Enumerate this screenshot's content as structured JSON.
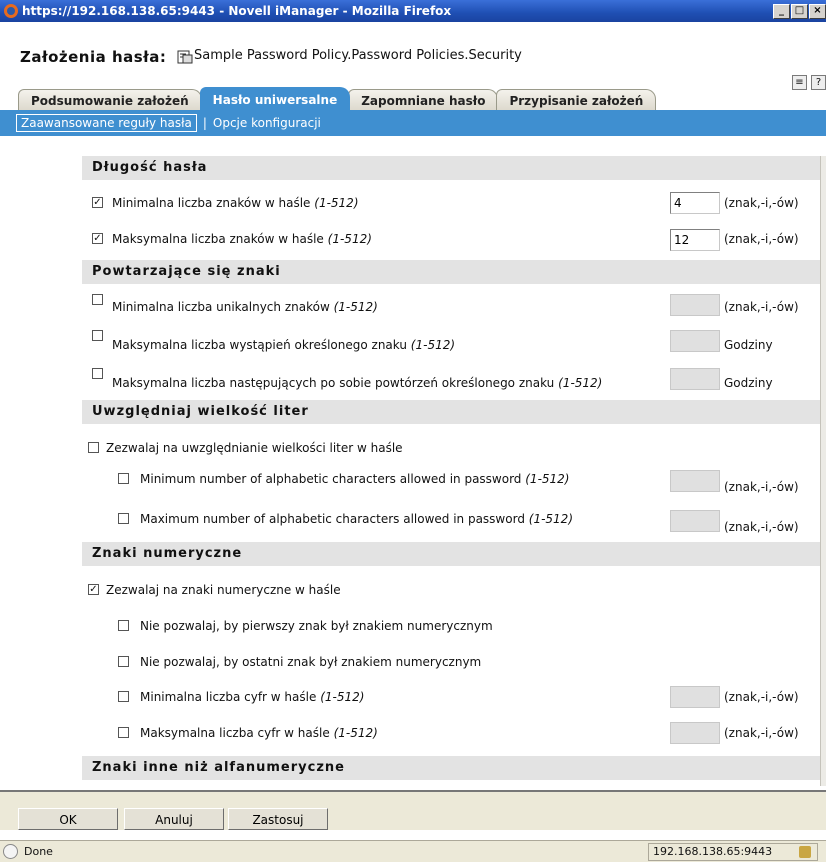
{
  "window": {
    "title": "https://192.168.138.65:9443 - Novell iManager - Mozilla Firefox"
  },
  "header": {
    "label": "Założenia hasła:",
    "object": "Sample Password Policy.Password Policies.Security"
  },
  "tabs": [
    {
      "label": "Podsumowanie założeń",
      "active": false
    },
    {
      "label": "Hasło uniwersalne",
      "active": true
    },
    {
      "label": "Zapomniane hasło",
      "active": false
    },
    {
      "label": "Przypisanie założeń",
      "active": false
    }
  ],
  "subnav": {
    "active": "Zaawansowane reguły hasła",
    "separator": "|",
    "other": "Opcje konfiguracji"
  },
  "sections": [
    {
      "title": "Długość hasła"
    },
    {
      "title": "Powtarzające się znaki"
    },
    {
      "title": "Uwzględniaj wielkość liter"
    },
    {
      "title": "Znaki numeryczne"
    },
    {
      "title": "Znaki inne niż alfanumeryczne"
    }
  ],
  "rules": [
    {
      "label": "Minimalna liczba znaków w haśle",
      "range": "(1-512)",
      "checked": true,
      "value": "4",
      "unit": "(znak,-i,-ów)"
    },
    {
      "label": "Maksymalna liczba znaków w haśle",
      "range": "(1-512)",
      "checked": true,
      "value": "12",
      "unit": "(znak,-i,-ów)"
    },
    {
      "label": "Minimalna liczba unikalnych znaków",
      "range": "(1-512)",
      "checked": false,
      "value": "",
      "unit": "(znak,-i,-ów)"
    },
    {
      "label": "Maksymalna liczba wystąpień określonego znaku",
      "range": "(1-512)",
      "checked": false,
      "value": "",
      "unit": "Godziny"
    },
    {
      "label": "Maksymalna liczba następujących po sobie powtórzeń określonego znaku",
      "range": "(1-512)",
      "checked": false,
      "value": "",
      "unit": "Godziny"
    },
    {
      "label": "Zezwalaj na uwzględnianie wielkości liter w haśle",
      "checked": false
    },
    {
      "label": "Minimum number of alphabetic characters allowed in password",
      "range": "(1-512)",
      "checked": false,
      "value": "",
      "unit": "(znak,-i,-ów)"
    },
    {
      "label": "Maximum number of alphabetic characters allowed in password",
      "range": "(1-512)",
      "checked": false,
      "value": "",
      "unit": "(znak,-i,-ów)"
    },
    {
      "label": "Zezwalaj na znaki numeryczne w haśle",
      "checked": true
    },
    {
      "label": "Nie pozwalaj, by pierwszy znak był znakiem numerycznym",
      "checked": false
    },
    {
      "label": "Nie pozwalaj, by ostatni znak był znakiem numerycznym",
      "checked": false
    },
    {
      "label": "Minimalna liczba cyfr w haśle",
      "range": "(1-512)",
      "checked": false,
      "value": "",
      "unit": "(znak,-i,-ów)"
    },
    {
      "label": "Maksymalna liczba cyfr w haśle",
      "range": "(1-512)",
      "checked": false,
      "value": "",
      "unit": "(znak,-i,-ów)"
    }
  ],
  "buttons": {
    "ok": "OK",
    "cancel": "Anuluj",
    "apply": "Zastosuj"
  },
  "status": {
    "text": "Done",
    "host": "192.168.138.65:9443"
  },
  "colors": {
    "tab_active": "#3f8fd0",
    "titlebar": "#1f4fb3"
  }
}
